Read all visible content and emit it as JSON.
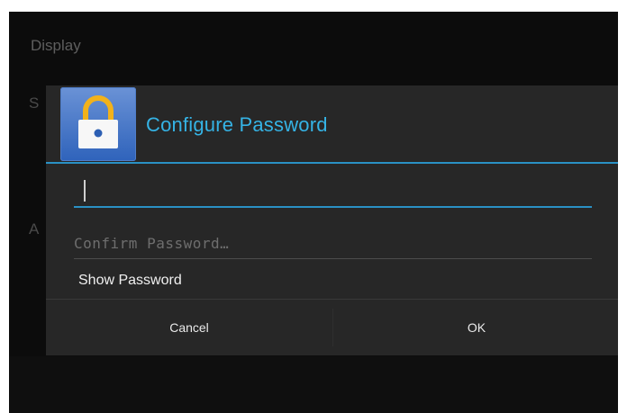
{
  "background": {
    "section_title": "Display",
    "section_sub": "",
    "frag_s": "S",
    "frag_a": "A"
  },
  "dialog": {
    "title": "Configure Password",
    "icon": "lock-icon",
    "accent_color": "#2a91c4",
    "title_color": "#35b3e5",
    "password_value": "",
    "confirm_placeholder": "Confirm Password…",
    "show_password_label": "Show Password",
    "cancel_label": "Cancel",
    "ok_label": "OK"
  }
}
